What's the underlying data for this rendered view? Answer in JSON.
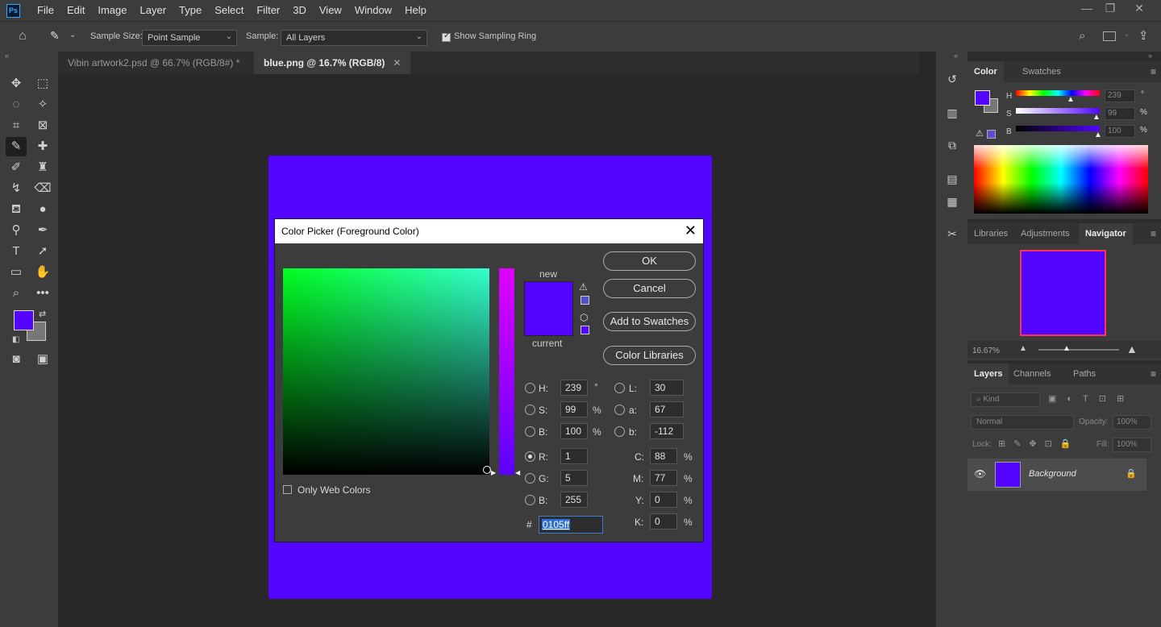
{
  "app": {
    "logo_text": "Ps",
    "menus": [
      "File",
      "Edit",
      "Image",
      "Layer",
      "Type",
      "Select",
      "Filter",
      "3D",
      "View",
      "Window",
      "Help"
    ]
  },
  "options_bar": {
    "sample_size_label": "Sample Size:",
    "sample_size_value": "Point Sample",
    "sample_label": "Sample:",
    "sample_value": "All Layers",
    "sampling_ring_label": "Show Sampling Ring",
    "sampling_ring_checked": true
  },
  "doc_tabs": [
    {
      "label": "Vibin artwork2.psd @ 66.7% (RGB/8#) *",
      "active": false
    },
    {
      "label": "blue.png @ 16.7% (RGB/8)",
      "active": true
    }
  ],
  "colors": {
    "foreground": "#5305ff",
    "document_fill": "#5305ff"
  },
  "color_panel": {
    "tabs": [
      "Color",
      "Swatches"
    ],
    "rows": [
      {
        "label": "H",
        "value": "239",
        "unit": "°"
      },
      {
        "label": "S",
        "value": "99",
        "unit": "%"
      },
      {
        "label": "B",
        "value": "100",
        "unit": "%"
      }
    ]
  },
  "navigator_panel": {
    "tabs": [
      "Libraries",
      "Adjustments",
      "Navigator"
    ],
    "zoom": "16.67%"
  },
  "layers_panel": {
    "tabs": [
      "Layers",
      "Channels",
      "Paths"
    ],
    "filter_placeholder": "Kind",
    "blend_mode": "Normal",
    "opacity_label": "Opacity:",
    "opacity_value": "100%",
    "lock_label": "Lock:",
    "fill_label": "Fill:",
    "fill_value": "100%",
    "layers": [
      {
        "name": "Background",
        "visible": true,
        "locked": true
      }
    ]
  },
  "color_picker": {
    "title": "Color Picker (Foreground Color)",
    "new_label": "new",
    "current_label": "current",
    "buttons": {
      "ok": "OK",
      "cancel": "Cancel",
      "add_to_swatches": "Add to Swatches",
      "color_libraries": "Color Libraries"
    },
    "only_web_colors": "Only Web Colors",
    "hsb": [
      {
        "label": "H:",
        "value": "239",
        "unit": "°",
        "selected": false
      },
      {
        "label": "S:",
        "value": "99",
        "unit": "%",
        "selected": false
      },
      {
        "label": "B:",
        "value": "100",
        "unit": "%",
        "selected": false
      }
    ],
    "rgb": [
      {
        "label": "R:",
        "value": "1",
        "selected": true
      },
      {
        "label": "G:",
        "value": "5",
        "selected": false
      },
      {
        "label": "B:",
        "value": "255",
        "selected": false
      }
    ],
    "lab": [
      {
        "label": "L:",
        "value": "30"
      },
      {
        "label": "a:",
        "value": "67"
      },
      {
        "label": "b:",
        "value": "-112"
      }
    ],
    "cmyk": [
      {
        "label": "C:",
        "value": "88",
        "unit": "%"
      },
      {
        "label": "M:",
        "value": "77",
        "unit": "%"
      },
      {
        "label": "Y:",
        "value": "0",
        "unit": "%"
      },
      {
        "label": "K:",
        "value": "0",
        "unit": "%"
      }
    ],
    "hex_label": "#",
    "hex_value": "0105ff"
  }
}
